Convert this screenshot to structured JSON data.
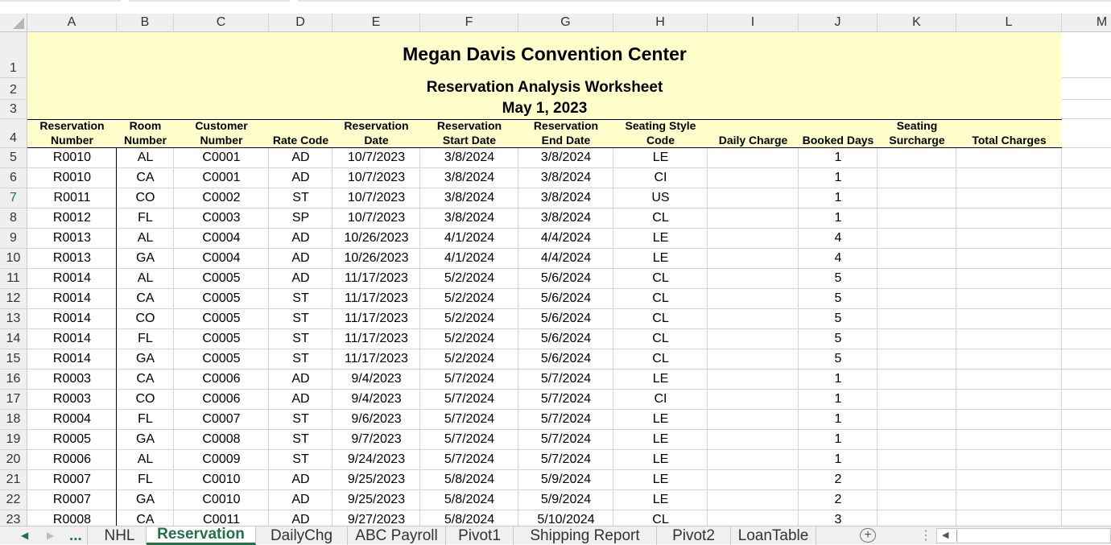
{
  "columns": [
    {
      "letter": "A",
      "w": 111
    },
    {
      "letter": "B",
      "w": 71
    },
    {
      "letter": "C",
      "w": 118
    },
    {
      "letter": "D",
      "w": 79
    },
    {
      "letter": "E",
      "w": 109
    },
    {
      "letter": "F",
      "w": 122
    },
    {
      "letter": "G",
      "w": 118
    },
    {
      "letter": "H",
      "w": 117
    },
    {
      "letter": "I",
      "w": 113
    },
    {
      "letter": "J",
      "w": 98
    },
    {
      "letter": "K",
      "w": 98
    },
    {
      "letter": "L",
      "w": 131
    },
    {
      "letter": "M",
      "w": 100
    }
  ],
  "title": "Megan Davis Convention Center",
  "subtitle": "Reservation Analysis Worksheet",
  "date": "May 1, 2023",
  "header_row": [
    [
      "Reservation",
      "Number"
    ],
    [
      "Room",
      "Number"
    ],
    [
      "Customer",
      "Number"
    ],
    [
      "",
      "Rate Code"
    ],
    [
      "Reservation",
      "Date"
    ],
    [
      "Reservation",
      "Start Date"
    ],
    [
      "Reservation",
      "End Date"
    ],
    [
      "Seating Style",
      "Code"
    ],
    [
      "",
      "Daily Charge"
    ],
    [
      "",
      "Booked Days"
    ],
    [
      "Seating",
      "Surcharge"
    ],
    [
      "",
      "Total Charges"
    ]
  ],
  "rows": [
    {
      "n": "5",
      "cells": [
        "R0010",
        "AL",
        "C0001",
        "AD",
        "10/7/2023",
        "3/8/2024",
        "3/8/2024",
        "LE",
        "",
        "1",
        "",
        ""
      ]
    },
    {
      "n": "6",
      "cells": [
        "R0010",
        "CA",
        "C0001",
        "AD",
        "10/7/2023",
        "3/8/2024",
        "3/8/2024",
        "CI",
        "",
        "1",
        "",
        ""
      ]
    },
    {
      "n": "7",
      "cells": [
        "R0011",
        "CO",
        "C0002",
        "ST",
        "10/7/2023",
        "3/8/2024",
        "3/8/2024",
        "US",
        "",
        "1",
        "",
        ""
      ]
    },
    {
      "n": "8",
      "cells": [
        "R0012",
        "FL",
        "C0003",
        "SP",
        "10/7/2023",
        "3/8/2024",
        "3/8/2024",
        "CL",
        "",
        "1",
        "",
        ""
      ]
    },
    {
      "n": "9",
      "cells": [
        "R0013",
        "AL",
        "C0004",
        "AD",
        "10/26/2023",
        "4/1/2024",
        "4/4/2024",
        "LE",
        "",
        "4",
        "",
        ""
      ]
    },
    {
      "n": "10",
      "cells": [
        "R0013",
        "GA",
        "C0004",
        "AD",
        "10/26/2023",
        "4/1/2024",
        "4/4/2024",
        "LE",
        "",
        "4",
        "",
        ""
      ]
    },
    {
      "n": "11",
      "cells": [
        "R0014",
        "AL",
        "C0005",
        "AD",
        "11/17/2023",
        "5/2/2024",
        "5/6/2024",
        "CL",
        "",
        "5",
        "",
        ""
      ]
    },
    {
      "n": "12",
      "cells": [
        "R0014",
        "CA",
        "C0005",
        "ST",
        "11/17/2023",
        "5/2/2024",
        "5/6/2024",
        "CL",
        "",
        "5",
        "",
        ""
      ]
    },
    {
      "n": "13",
      "cells": [
        "R0014",
        "CO",
        "C0005",
        "ST",
        "11/17/2023",
        "5/2/2024",
        "5/6/2024",
        "CL",
        "",
        "5",
        "",
        ""
      ]
    },
    {
      "n": "14",
      "cells": [
        "R0014",
        "FL",
        "C0005",
        "ST",
        "11/17/2023",
        "5/2/2024",
        "5/6/2024",
        "CL",
        "",
        "5",
        "",
        ""
      ]
    },
    {
      "n": "15",
      "cells": [
        "R0014",
        "GA",
        "C0005",
        "ST",
        "11/17/2023",
        "5/2/2024",
        "5/6/2024",
        "CL",
        "",
        "5",
        "",
        ""
      ]
    },
    {
      "n": "16",
      "cells": [
        "R0003",
        "CA",
        "C0006",
        "AD",
        "9/4/2023",
        "5/7/2024",
        "5/7/2024",
        "LE",
        "",
        "1",
        "",
        ""
      ]
    },
    {
      "n": "17",
      "cells": [
        "R0003",
        "CO",
        "C0006",
        "AD",
        "9/4/2023",
        "5/7/2024",
        "5/7/2024",
        "CI",
        "",
        "1",
        "",
        ""
      ]
    },
    {
      "n": "18",
      "cells": [
        "R0004",
        "FL",
        "C0007",
        "ST",
        "9/6/2023",
        "5/7/2024",
        "5/7/2024",
        "LE",
        "",
        "1",
        "",
        ""
      ]
    },
    {
      "n": "19",
      "cells": [
        "R0005",
        "GA",
        "C0008",
        "ST",
        "9/7/2023",
        "5/7/2024",
        "5/7/2024",
        "LE",
        "",
        "1",
        "",
        ""
      ]
    },
    {
      "n": "20",
      "cells": [
        "R0006",
        "AL",
        "C0009",
        "ST",
        "9/24/2023",
        "5/7/2024",
        "5/7/2024",
        "LE",
        "",
        "1",
        "",
        ""
      ]
    },
    {
      "n": "21",
      "cells": [
        "R0007",
        "FL",
        "C0010",
        "AD",
        "9/25/2023",
        "5/8/2024",
        "5/9/2024",
        "LE",
        "",
        "2",
        "",
        ""
      ]
    },
    {
      "n": "22",
      "cells": [
        "R0007",
        "GA",
        "C0010",
        "AD",
        "9/25/2023",
        "5/8/2024",
        "5/9/2024",
        "LE",
        "",
        "2",
        "",
        ""
      ]
    },
    {
      "n": "23",
      "cells": [
        "R0008",
        "CA",
        "C0011",
        "AD",
        "9/27/2023",
        "5/8/2024",
        "5/10/2024",
        "CL",
        "",
        "3",
        "",
        ""
      ]
    }
  ],
  "selected_row": "7",
  "tabs": {
    "more": "...",
    "items": [
      "NHL",
      "Reservation",
      "DailyChg",
      "ABC Payroll",
      "Pivot1",
      "Shipping Report",
      "Pivot2",
      "LoanTable"
    ],
    "active": "Reservation",
    "add_label": "+",
    "options": "⋮"
  },
  "colors": {
    "title_fill": "#ffffcc",
    "accent": "#217346"
  }
}
